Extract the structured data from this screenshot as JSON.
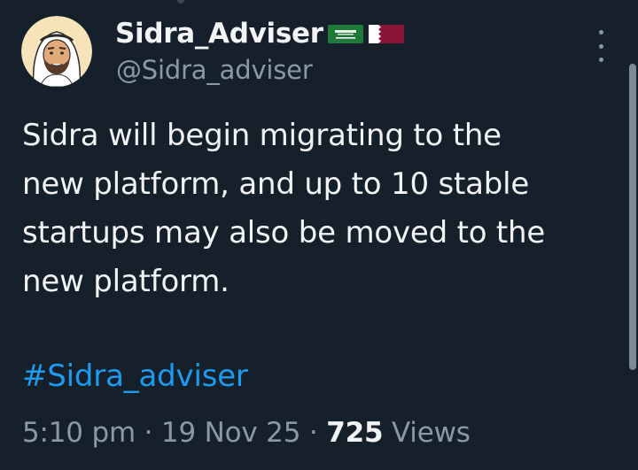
{
  "author": {
    "display_name": "Sidra_Adviser",
    "handle": "@Sidra_adviser",
    "flags": [
      "saudi-arabia-flag",
      "qatar-flag"
    ]
  },
  "tweet": {
    "lines": [
      "Sidra will begin migrating to the",
      "new platform, and up to 10 stable",
      "startups may also be moved to the",
      "new platform."
    ],
    "hashtag": "#Sidra_adviser"
  },
  "meta": {
    "time": "5:10 pm",
    "separator": " · ",
    "date": "19 Nov 25",
    "views_count": "725",
    "views_label": "Views"
  },
  "colors": {
    "background": "#15202b",
    "text": "#f1f3f4",
    "secondary": "#8b98a5",
    "link": "#1d9bf0"
  }
}
